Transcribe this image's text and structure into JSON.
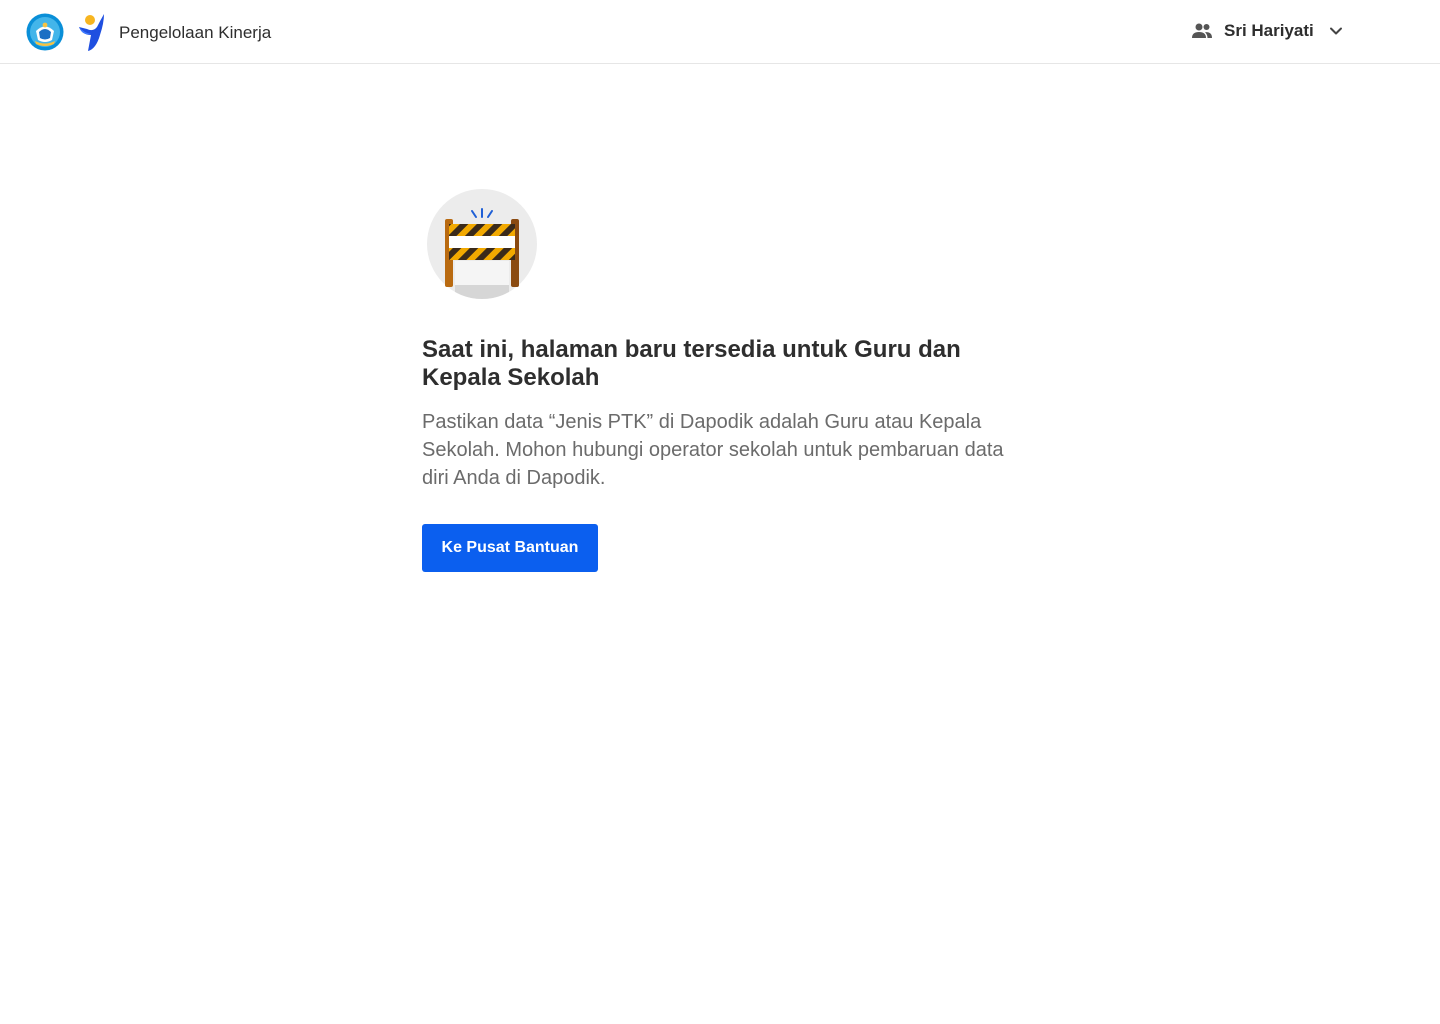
{
  "header": {
    "app_title": "Pengelolaan Kinerja",
    "user_name": "Sri Hariyati"
  },
  "main": {
    "heading": "Saat ini, halaman baru tersedia untuk Guru dan Kepala Sekolah",
    "description": "Pastikan data “Jenis PTK” di Dapodik adalah Guru atau Kepala Sekolah. Mohon hubungi operator sekolah untuk pembaruan data diri Anda di Dapodik.",
    "button_label": "Ke Pusat Bantuan"
  },
  "icons": {
    "logo_left": "kemdikbud-logo-icon",
    "logo_right": "merdeka-mengajar-logo-icon",
    "user": "users-icon",
    "chevron": "chevron-down-icon",
    "illustration": "road-barrier-icon"
  },
  "colors": {
    "primary_button": "#0b5fef",
    "heading_text": "#2e2e2e",
    "body_text": "#6b6b6b",
    "border": "#e6e6e6"
  }
}
